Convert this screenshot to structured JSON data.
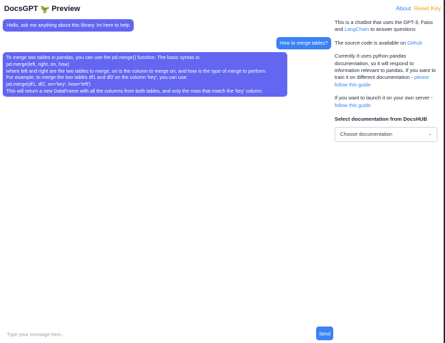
{
  "header": {
    "title": "DocsGPT",
    "emoji": "🦖",
    "subtitle": "Preview",
    "about": "About",
    "reset": "Reset Key"
  },
  "chat": {
    "messages": [
      {
        "role": "bot",
        "text": "Hello, ask me anything about this library. Im here to help"
      },
      {
        "role": "user",
        "text": "How to merge tables?"
      },
      {
        "role": "bot",
        "lines": [
          "To merge two tables in pandas, you can use the pd.merge() function. The basic syntax is:",
          "pd.merge(left, right, on, how)",
          "where left and right are the two tables to merge, on is the column to merge on, and how is the type of merge to perform.",
          "For example, to merge the two tables df1 and df2 on the column 'key', you can use:",
          "pd.merge(df1, df2, on='key', how='left')",
          "This will return a new DataFrame with all the columns from both tables, and only the rows that match the 'key' column."
        ]
      }
    ],
    "input_placeholder": "Type your message here...",
    "send_label": "Send"
  },
  "sidebar": {
    "intro_pre": "This is a chatbot that uses the GPT-3, Faiss and ",
    "intro_link": "LangChain",
    "intro_post": " to answer questions",
    "source_pre": "The source code is available on ",
    "source_link": "Github",
    "current_text": "Currently It uses python pandas documentation, so it will respond to information relevant to pandas. If you want to train it on different documentation - ",
    "current_link": "please follow this guide",
    "launch_text": "If you want to launch it on your own server - ",
    "launch_link": "follow this guide",
    "select_label": "Select documentation from DocsHUB",
    "select_value": "Choose documentation"
  },
  "colors": {
    "bot_bubble": "#6366f1",
    "user_bubble": "#3b82f6",
    "link": "#3b82f6",
    "reset_link": "#f59e0b"
  }
}
